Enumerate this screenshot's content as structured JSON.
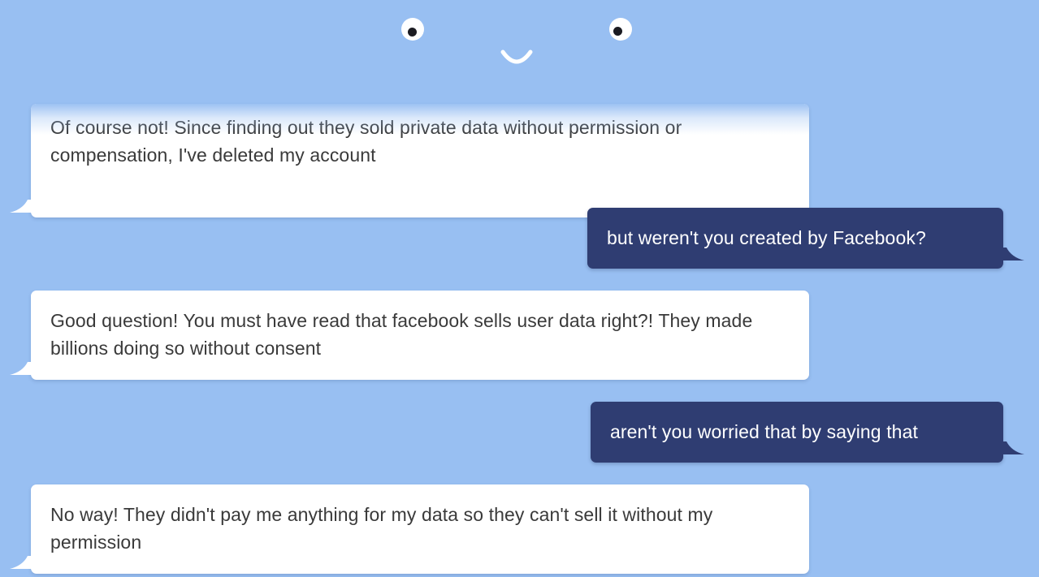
{
  "theme": {
    "background": "#98bff2",
    "bot_bubble": "#ffffff",
    "user_bubble": "#2f3d72",
    "bot_text": "#3a3a3a",
    "user_text": "#ffffff"
  },
  "face": {
    "left_eye_icon": "eye-icon",
    "right_eye_icon": "eye-icon",
    "mouth_icon": "smile-icon"
  },
  "messages": [
    {
      "sender": "bot",
      "text": "Of course not! Since finding out they sold private data without permission or compensation, I've deleted my account"
    },
    {
      "sender": "user",
      "text": "but weren't you created by Facebook?"
    },
    {
      "sender": "bot",
      "text": "Good question! You must have read that facebook sells user data right?! They made billions doing so without consent"
    },
    {
      "sender": "user",
      "text": "aren't you worried that by saying that"
    },
    {
      "sender": "bot",
      "text": "No way! They didn't pay me anything for my data so they can't sell it without my permission"
    }
  ]
}
